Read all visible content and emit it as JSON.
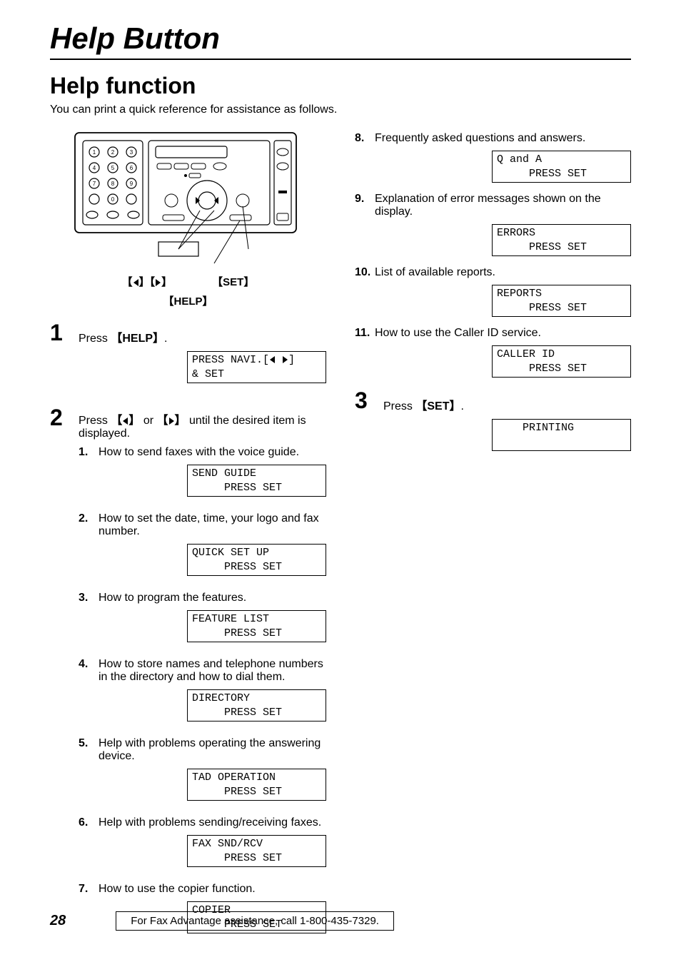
{
  "page_title": "Help Button",
  "section_title": "Help function",
  "lead": "You can print a quick reference for assistance as follows.",
  "diagram": {
    "label_nav": "【 ◀ 】【 ▶ 】",
    "label_set": "【SET】",
    "label_help": "【HELP】"
  },
  "step1": {
    "num": "1",
    "text_before": "Press ",
    "button": "【HELP】",
    "text_after": ".",
    "display": "PRESS NAVI.[◀ ▶]\n& SET"
  },
  "step2": {
    "num": "2",
    "text_before": "Press ",
    "btn_left": "【 ◀ 】",
    "or": " or ",
    "btn_right": "【 ▶ 】",
    "text_after": " until the desired item is displayed.",
    "items": [
      {
        "n": "1.",
        "text": "How to send faxes with the voice guide.",
        "display": "SEND GUIDE\n     PRESS SET"
      },
      {
        "n": "2.",
        "text": "How to set the date, time, your logo and fax number.",
        "display": "QUICK SET UP\n     PRESS SET"
      },
      {
        "n": "3.",
        "text": "How to program the features.",
        "display": "FEATURE LIST\n     PRESS SET"
      },
      {
        "n": "4.",
        "text": "How to store names and telephone numbers in the directory and how to dial them.",
        "display": "DIRECTORY\n     PRESS SET"
      },
      {
        "n": "5.",
        "text": "Help with problems operating the answering device.",
        "display": "TAD OPERATION\n     PRESS SET"
      },
      {
        "n": "6.",
        "text": "Help with problems sending/receiving faxes.",
        "display": "FAX SND/RCV\n     PRESS SET"
      },
      {
        "n": "7.",
        "text": "How to use the copier function.",
        "display": "COPIER\n     PRESS SET"
      }
    ]
  },
  "step2_right": {
    "items": [
      {
        "n": "8.",
        "text": "Frequently asked questions and answers.",
        "display": "Q and A\n     PRESS SET"
      },
      {
        "n": "9.",
        "text": "Explanation of error messages shown on the display.",
        "display": "ERRORS\n     PRESS SET"
      },
      {
        "n": "10.",
        "text": "List of available reports.",
        "display": "REPORTS\n     PRESS SET"
      },
      {
        "n": "11.",
        "text": "How to use the Caller ID service.",
        "display": "CALLER ID\n     PRESS SET"
      }
    ]
  },
  "step3": {
    "num": "3",
    "text_before": "Press ",
    "button": "【SET】",
    "text_after": ".",
    "display": "    PRINTING\n "
  },
  "footer": {
    "page": "28",
    "text": "For Fax Advantage assistance, call 1-800-435-7329."
  }
}
